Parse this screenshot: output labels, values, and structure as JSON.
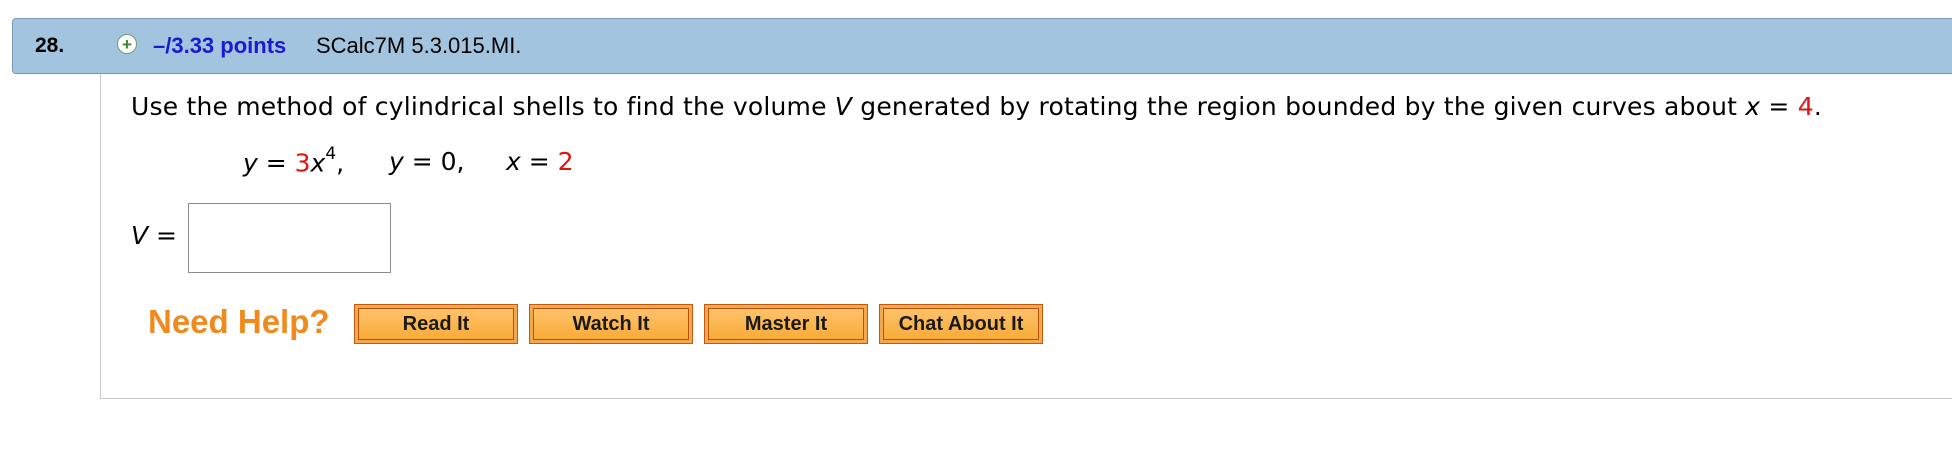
{
  "header": {
    "number": "28.",
    "points": "–/3.33 points",
    "course_ref": "SCalc7M 5.3.015.MI."
  },
  "question": {
    "part1": "Use the method of cylindrical shells to find the volume ",
    "var_v": "V",
    "part2": " generated by rotating the region bounded by the given curves about ",
    "var_x": "x",
    "eq_sign": " = ",
    "axis_value": "4",
    "end": "."
  },
  "curves": {
    "c1_var": "y",
    "c1_eq": " = ",
    "c1_coef": "3",
    "c1_x": "x",
    "c1_exp": "4",
    "c1_sep": ",",
    "c2_var": "y",
    "c2_eq": " = 0,",
    "c3_var": "x",
    "c3_eq": " = ",
    "c3_val": "2"
  },
  "answer": {
    "label_var": "V",
    "label_eq": " =",
    "value": ""
  },
  "help": {
    "title": "Need Help?",
    "read_it": "Read It",
    "watch_it": "Watch It",
    "master_it": "Master It",
    "chat_about_it": "Chat About It"
  },
  "colors": {
    "header_bg": "#a3c4df",
    "points_blue": "#1a1ad2",
    "red_values": "#e0140f",
    "need_help_orange": "#f08a1e",
    "button_orange": "#f8ab38"
  },
  "icons": {
    "expand": "plus-circle-icon"
  }
}
